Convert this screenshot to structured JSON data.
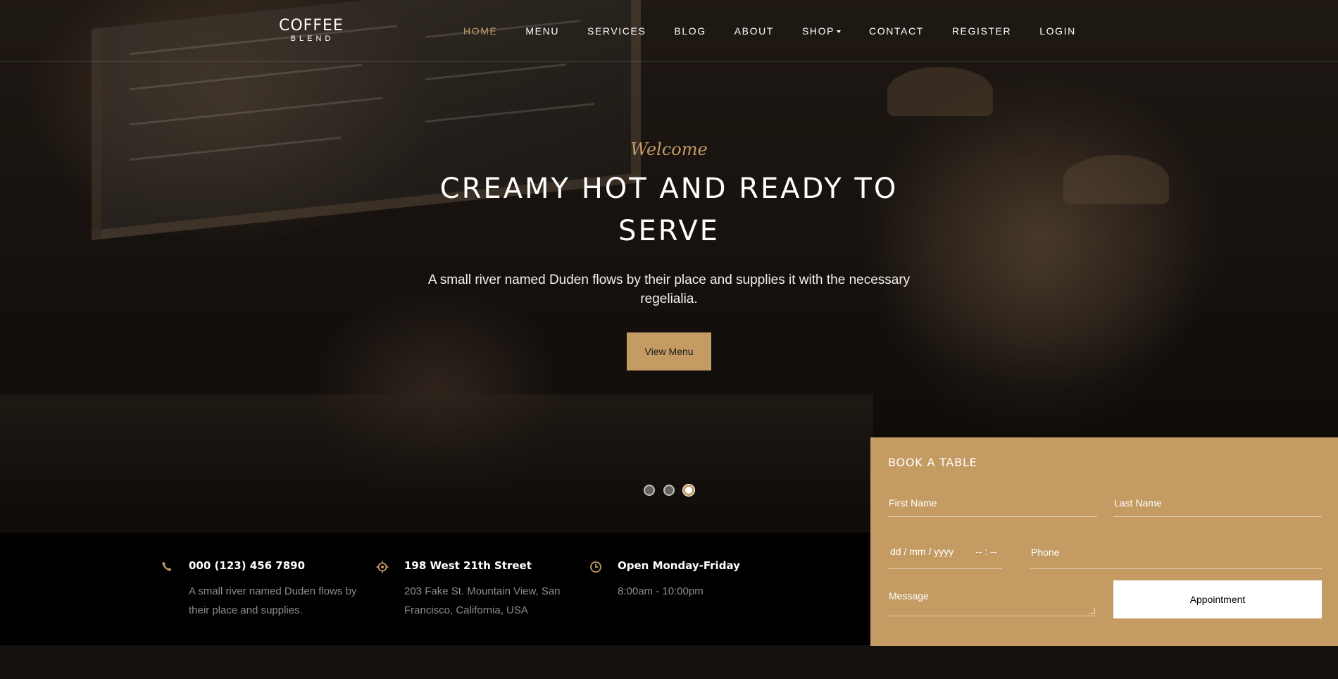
{
  "brand": {
    "name": "COFFEE",
    "tagline": "BLEND"
  },
  "nav": {
    "items": [
      {
        "label": "HOME",
        "active": true
      },
      {
        "label": "MENU"
      },
      {
        "label": "SERVICES"
      },
      {
        "label": "BLOG"
      },
      {
        "label": "ABOUT"
      },
      {
        "label": "SHOP",
        "has_dropdown": true
      },
      {
        "label": "CONTACT"
      },
      {
        "label": "REGISTER"
      },
      {
        "label": "LOGIN"
      }
    ]
  },
  "hero": {
    "welcome": "Welcome",
    "headline": "CREAMY HOT AND READY TO SERVE",
    "subline": "A small river named Duden flows by their place and supplies it with the necessary regelialia.",
    "button": "View Menu",
    "slides": {
      "count": 3,
      "active_index": 2
    }
  },
  "info": [
    {
      "icon": "phone-icon",
      "title": "000 (123) 456 7890",
      "text": "A small river named Duden flows by their place and supplies."
    },
    {
      "icon": "location-icon",
      "title": "198 West 21th Street",
      "text": "203 Fake St. Mountain View, San Francisco, California, USA"
    },
    {
      "icon": "clock-icon",
      "title": "Open Monday-Friday",
      "text": "8:00am - 10:00pm"
    }
  ],
  "booking": {
    "title": "BOOK A TABLE",
    "first_name_placeholder": "First Name",
    "last_name_placeholder": "Last Name",
    "date_placeholder": "dd / mm / yyyy",
    "time_placeholder": "-- : --",
    "phone_placeholder": "Phone",
    "message_placeholder": "Message",
    "button": "Appointment"
  },
  "colors": {
    "accent": "#c49b63",
    "info_bar": "#000000",
    "page_bg": "#13100d"
  }
}
